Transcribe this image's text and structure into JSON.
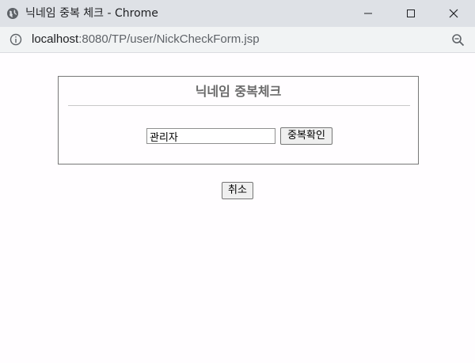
{
  "window": {
    "title": "닉네임 중복 체크 - Chrome"
  },
  "address": {
    "host": "localhost",
    "path": ":8080/TP/user/NickCheckForm.jsp"
  },
  "form": {
    "heading": "닉네임 중복체크",
    "nickname_value": "관리자",
    "check_button_label": "중복확인",
    "cancel_button_label": "취소"
  },
  "icons": {
    "page": "globe-icon",
    "minimize": "minimize-icon",
    "maximize": "maximize-icon",
    "close": "close-icon",
    "site_info": "info-icon",
    "zoom": "zoom-icon"
  }
}
